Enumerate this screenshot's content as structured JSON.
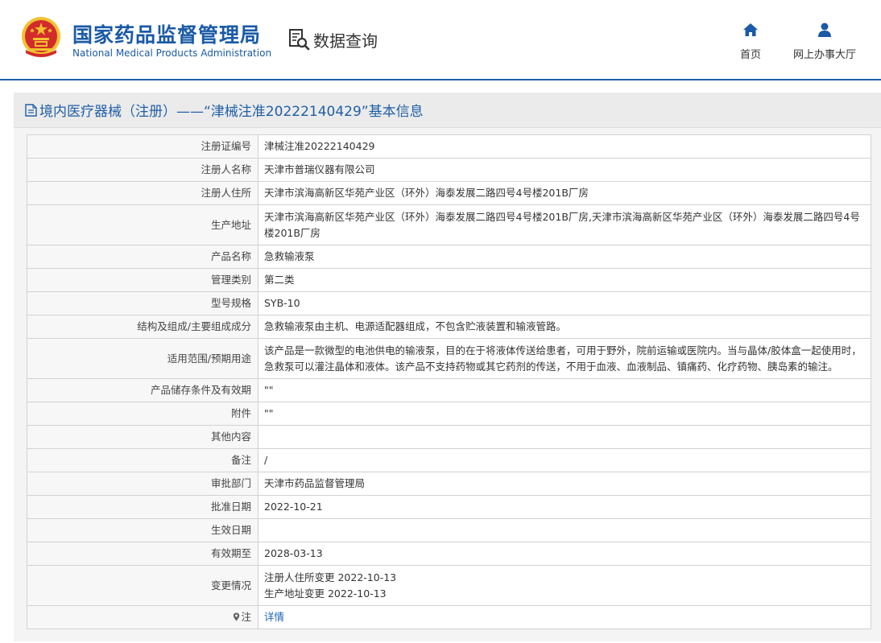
{
  "header": {
    "title_cn": "国家药品监督管理局",
    "title_en": "National Medical Products Administration",
    "query_label": "数据查询",
    "nav": [
      {
        "label": "首页",
        "icon": "home-icon"
      },
      {
        "label": "网上办事大厅",
        "icon": "user-icon"
      }
    ]
  },
  "colors": {
    "brand_blue": "#1a5aa6",
    "header_line": "#1c5fa8",
    "emblem_red": "#d22b2b",
    "emblem_gold": "#f2c230",
    "link_blue": "#1a63b8"
  },
  "panel": {
    "title": "境内医疗器械（注册）——“津械注准20222140429”基本信息"
  },
  "rows": [
    {
      "label": "注册证编号",
      "value": "津械注准20222140429"
    },
    {
      "label": "注册人名称",
      "value": "天津市普瑞仪器有限公司"
    },
    {
      "label": "注册人住所",
      "value": "天津市滨海高新区华苑产业区（环外）海泰发展二路四号4号楼201B厂房"
    },
    {
      "label": "生产地址",
      "value": "天津市滨海高新区华苑产业区（环外）海泰发展二路四号4号楼201B厂房,天津市滨海高新区华苑产业区（环外）海泰发展二路四号4号楼201B厂房"
    },
    {
      "label": "产品名称",
      "value": "急救输液泵"
    },
    {
      "label": "管理类别",
      "value": "第二类"
    },
    {
      "label": "型号规格",
      "value": "SYB-10"
    },
    {
      "label": "结构及组成/主要组成成分",
      "value": "急救输液泵由主机、电源适配器组成，不包含贮液装置和输液管路。"
    },
    {
      "label": "适用范围/预期用途",
      "value": "该产品是一款微型的电池供电的输液泵，目的在于将液体传送给患者，可用于野外，院前运输或医院内。当与晶体/胶体盒一起使用时，急救泵可以灌注晶体和液体。该产品不支持药物或其它药剂的传送，不用于血液、血液制品、镇痛药、化疗药物、胰岛素的输注。"
    },
    {
      "label": "产品储存条件及有效期",
      "value": "\"\""
    },
    {
      "label": "附件",
      "value": "\"\""
    },
    {
      "label": "其他内容",
      "value": ""
    },
    {
      "label": "备注",
      "value": "/"
    },
    {
      "label": "审批部门",
      "value": "天津市药品监督管理局"
    },
    {
      "label": "批准日期",
      "value": "2022-10-21"
    },
    {
      "label": "生效日期",
      "value": ""
    },
    {
      "label": "有效期至",
      "value": "2028-03-13"
    },
    {
      "label": "变更情况",
      "lines": [
        "注册人住所变更 2022-10-13",
        "生产地址变更 2022-10-13"
      ]
    },
    {
      "label": "注",
      "value": "详情",
      "icon": "location-pin-icon"
    }
  ]
}
